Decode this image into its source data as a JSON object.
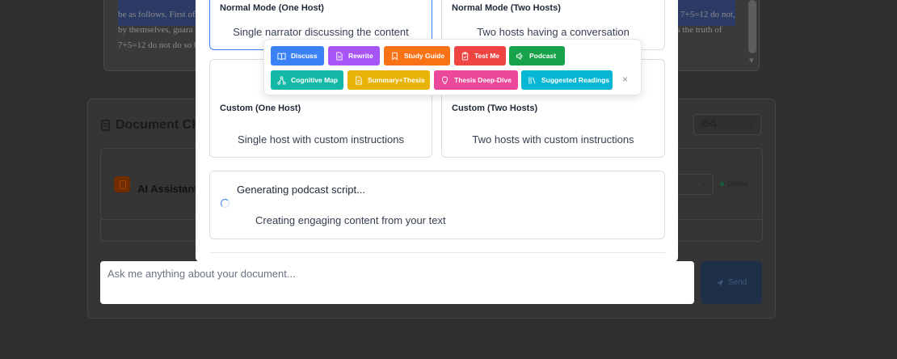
{
  "background": {
    "doc_lines": [
      "be as follows. First of",
      "7+5=12 do not,",
      "by themselves, guara",
      "us the truth of",
      "7+5=12 do not do so b"
    ],
    "chat_title": "Document Ch",
    "language": "ZH1",
    "assistant_name": "AI Assistant",
    "status": "Online",
    "send_label": "Send"
  },
  "modal": {
    "modes": [
      {
        "title": "Normal Mode (One Host)",
        "desc": "Single narrator discussing the content"
      },
      {
        "title": "Normal Mode (Two Hosts)",
        "desc": "Two hosts having a conversation"
      },
      {
        "title": "Custom (One Host)",
        "desc": "Single host with custom instructions"
      },
      {
        "title": "Custom (Two Hosts)",
        "desc": "Two hosts with custom instructions"
      }
    ],
    "progress": {
      "title": "Generating podcast script...",
      "subtitle": "Creating engaging content from your text"
    }
  },
  "chat_input": {
    "placeholder": "Ask me anything about your document..."
  },
  "toolbar": {
    "buttons": [
      {
        "label": "Discuss",
        "icon": "book-open-icon",
        "color": "#3b82f6"
      },
      {
        "label": "Rewrite",
        "icon": "file-text-icon",
        "color": "#a855f7"
      },
      {
        "label": "Study Guide",
        "icon": "bookmark-icon",
        "color": "#f97316"
      },
      {
        "label": "Test Me",
        "icon": "clipboard-icon",
        "color": "#ef4444"
      },
      {
        "label": "Podcast",
        "icon": "speaker-icon",
        "color": "#16a34a"
      },
      {
        "label": "Cognitive Map",
        "icon": "network-icon",
        "color": "#14b8a6"
      },
      {
        "label": "Summary+Thesis",
        "icon": "document-icon",
        "color": "#eab308"
      },
      {
        "label": "Thesis Deep-Dive",
        "icon": "lightbulb-icon",
        "color": "#ec4899"
      },
      {
        "label": "Suggested Readings",
        "icon": "library-icon",
        "color": "#06b6d4"
      }
    ],
    "close_label": "×"
  }
}
